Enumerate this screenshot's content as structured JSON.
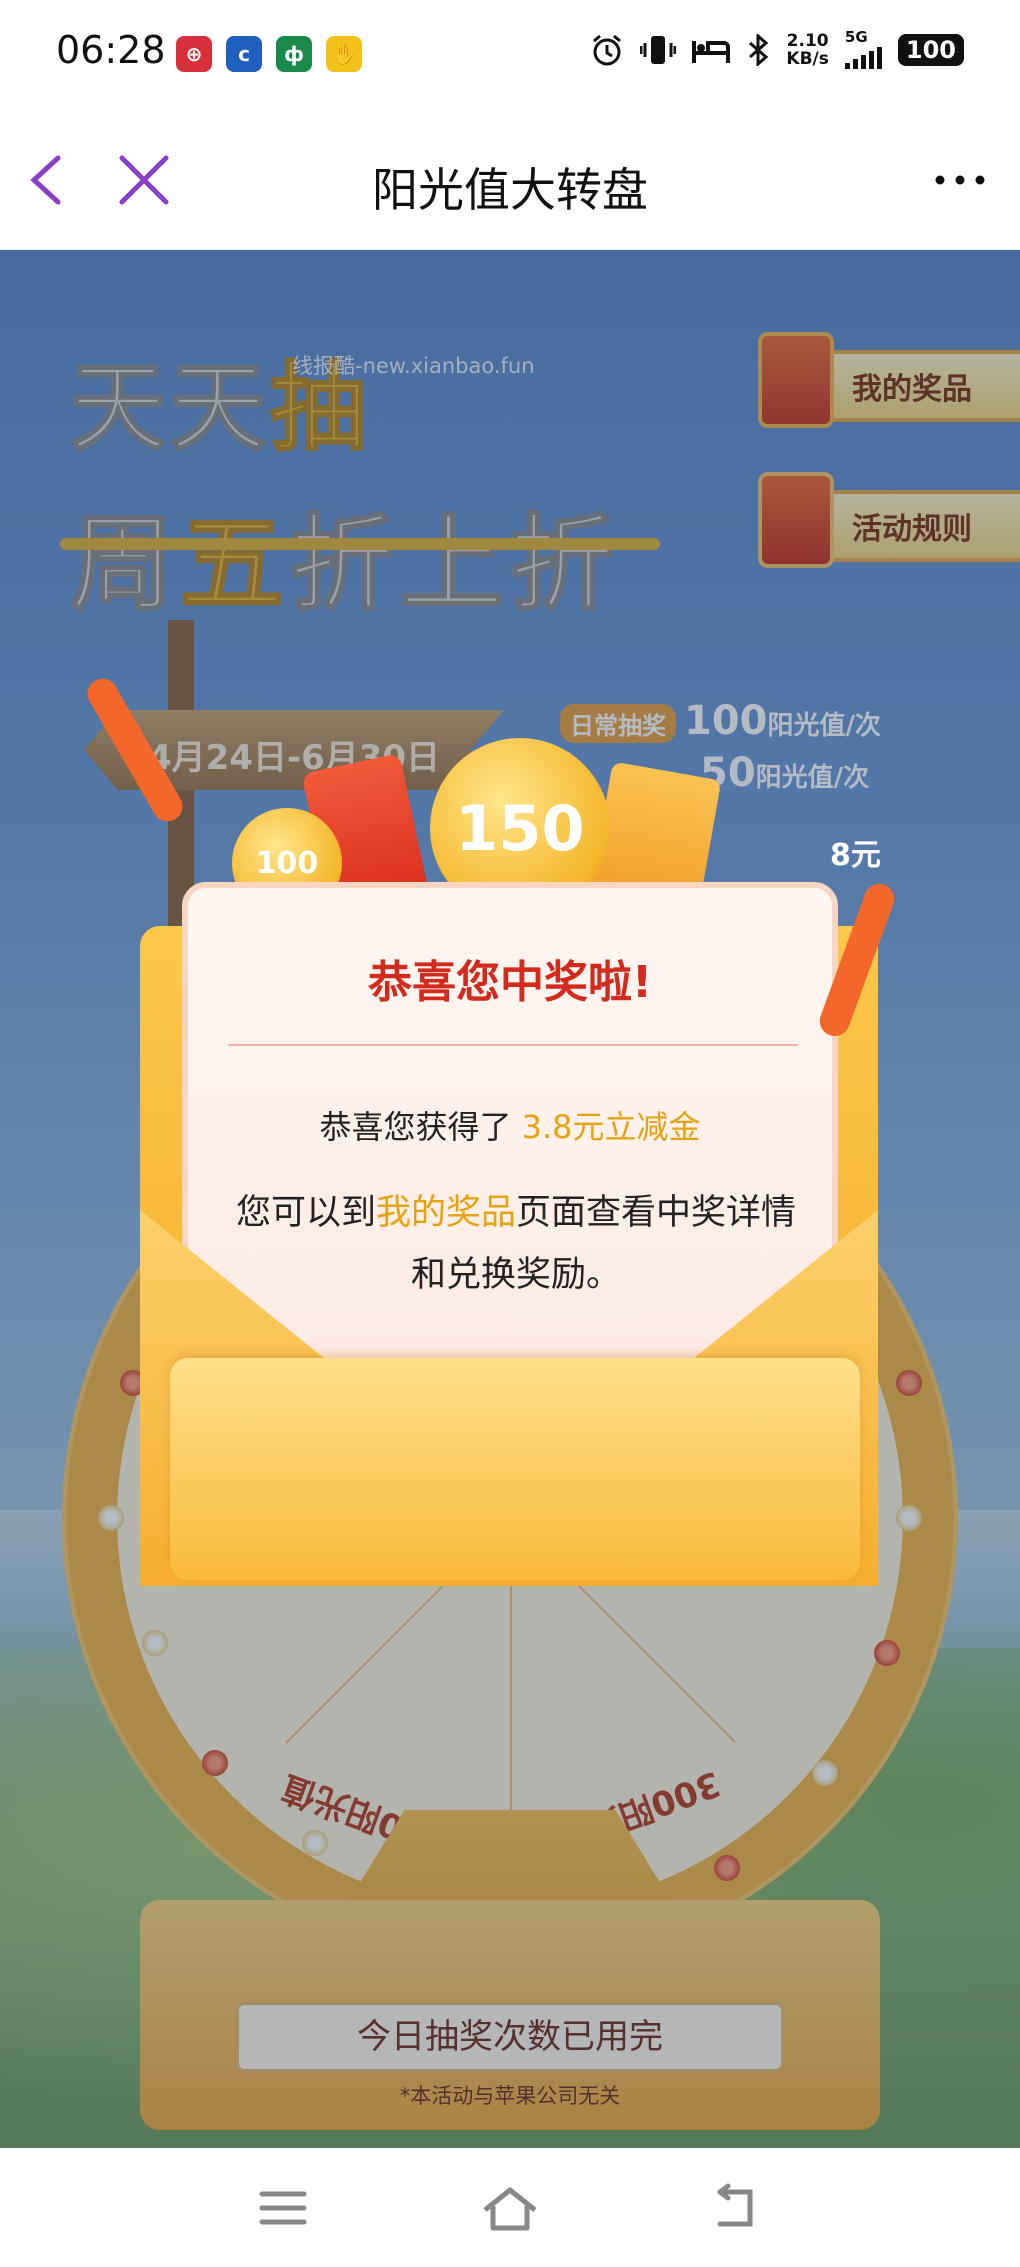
{
  "status_bar": {
    "time": "06:28",
    "speed_value": "2.10",
    "speed_unit": "KB/s",
    "network": "5G",
    "battery": "100"
  },
  "nav": {
    "title": "阳光值大转盘"
  },
  "banner": {
    "headline_line1_prefix": "天天",
    "headline_line1_highlight": "抽",
    "headline_line2_prefix": "周",
    "headline_line2_highlight": "五",
    "headline_line2_suffix": "折上折",
    "watermark": "线报酷-new.xianbao.fun"
  },
  "side_buttons": {
    "my_prizes": "我的奖品",
    "rules": "活动规则"
  },
  "sign": {
    "dates": "4月24日-6月30日"
  },
  "costs": {
    "daily_tag": "日常抽奖",
    "daily_value": "100",
    "daily_unit": "阳光值/次",
    "friday_value": "50",
    "friday_unit": "阳光值/次"
  },
  "wheel": {
    "segment_left": "50阳光值",
    "segment_right": "300阳光值"
  },
  "prize_visual": {
    "coin_large": "150",
    "coin_small": "100",
    "side_amount": "8元"
  },
  "modal": {
    "title": "恭喜您中奖啦!",
    "line1_prefix": "恭喜您获得了 ",
    "line1_prize": "3.8元立减金",
    "line2_prefix": "您可以到",
    "line2_link": "我的奖品",
    "line2_suffix": "页面查看中奖详情和兑换奖励。"
  },
  "footer": {
    "draw_button": "今日抽奖次数已用完",
    "disclaimer": "*本活动与苹果公司无关"
  },
  "colors": {
    "accent_gold": "#e6a20f",
    "title_red": "#d22b1d",
    "nav_purple": "#8a3fc8"
  }
}
